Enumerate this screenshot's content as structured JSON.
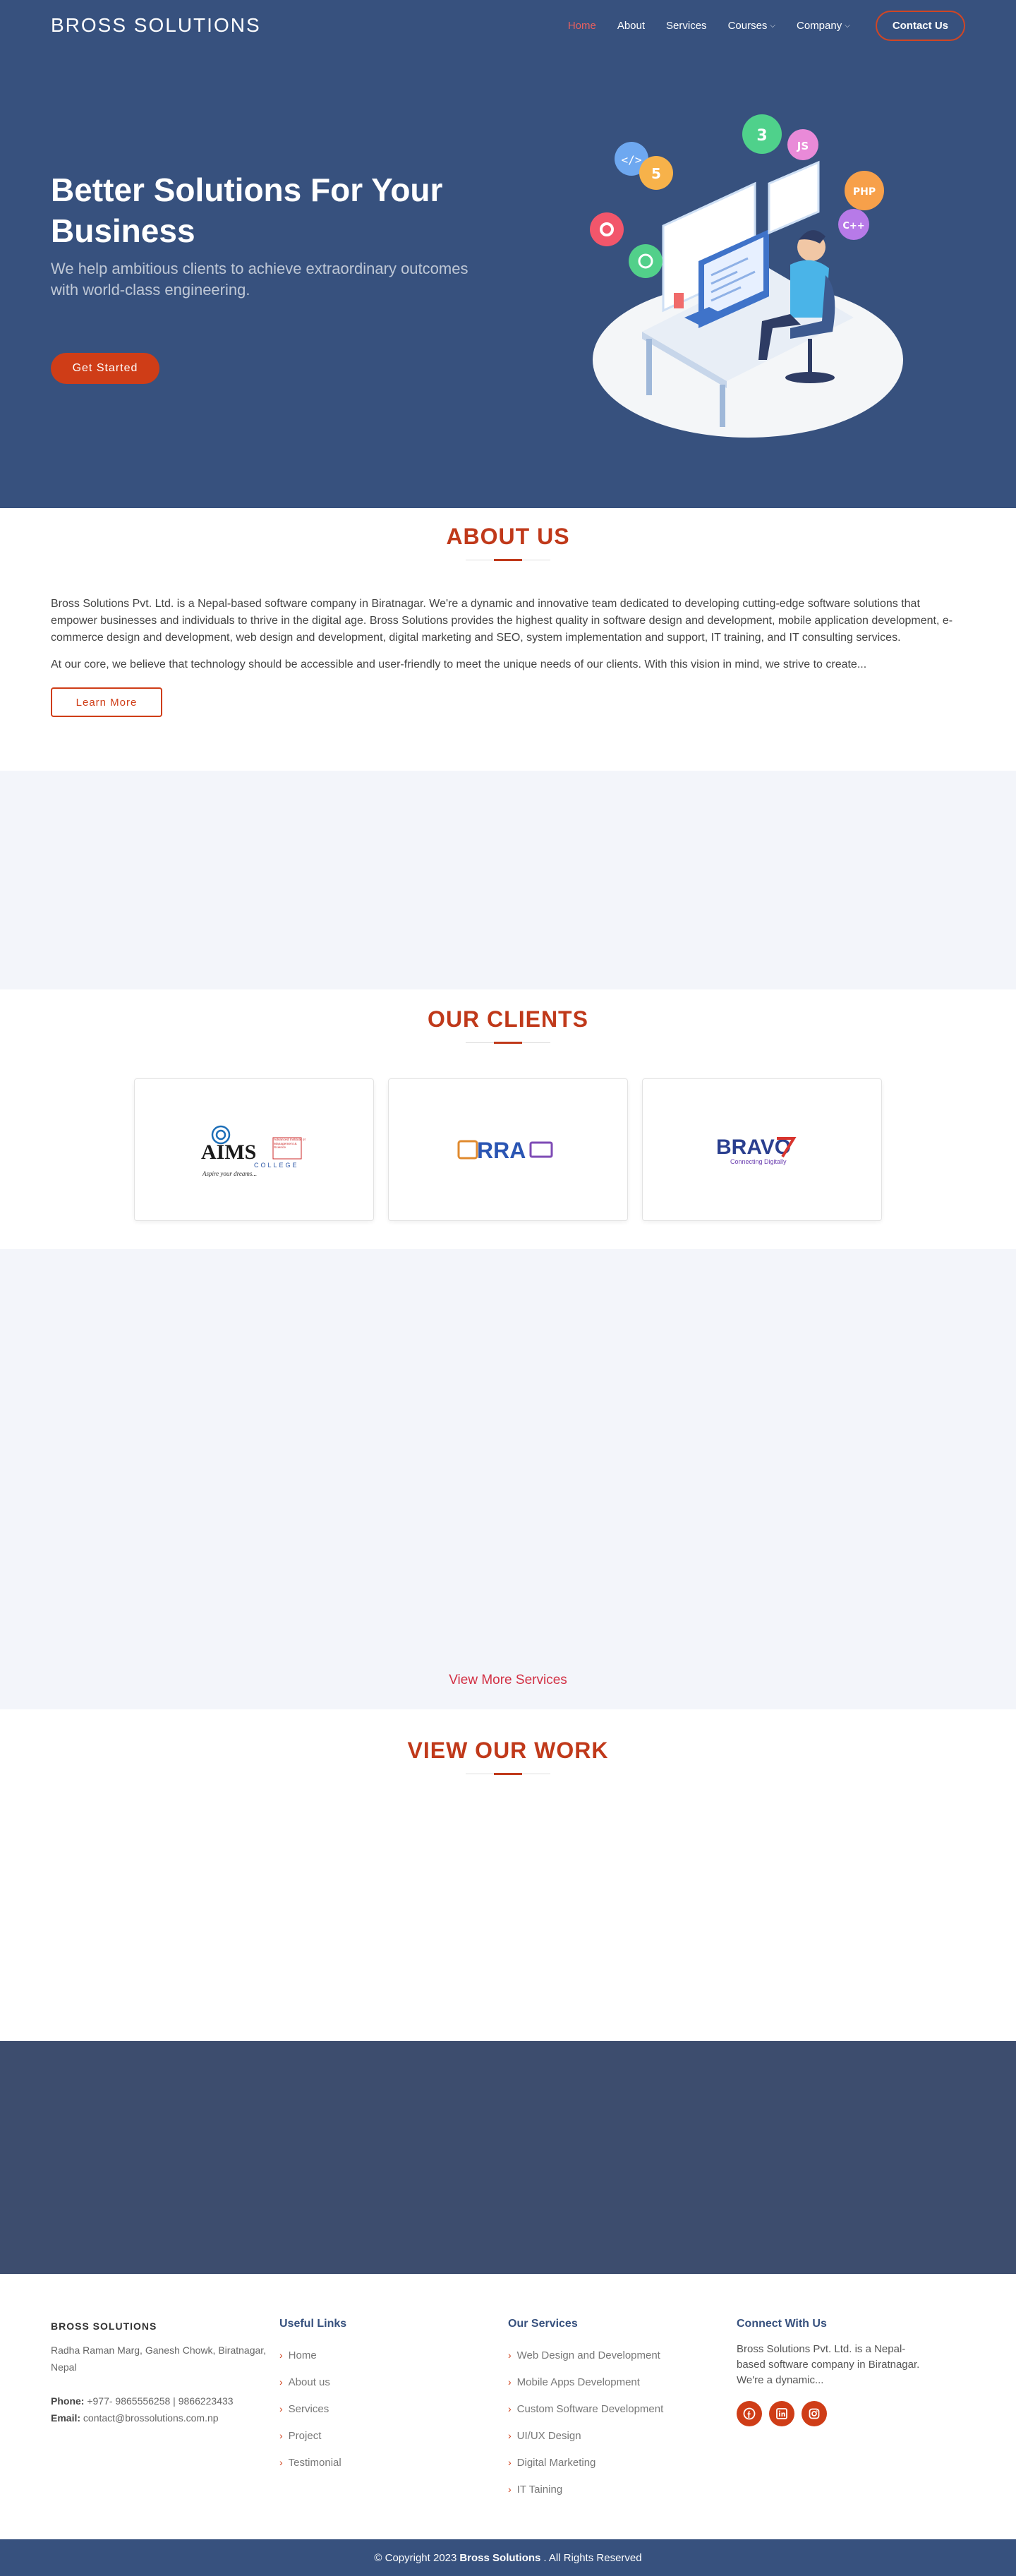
{
  "nav": {
    "brand": "BROSS SOLUTIONS",
    "items": [
      {
        "label": "Home",
        "active": true,
        "dropdown": false
      },
      {
        "label": "About",
        "active": false,
        "dropdown": false
      },
      {
        "label": "Services",
        "active": false,
        "dropdown": false
      },
      {
        "label": "Courses",
        "active": false,
        "dropdown": true
      },
      {
        "label": "Company",
        "active": false,
        "dropdown": true
      }
    ],
    "contact_label": "Contact Us"
  },
  "hero": {
    "title": "Better Solutions For Your Business",
    "subtitle": "We help ambitious clients to achieve extraordinary outcomes with world-class engineering.",
    "cta": "Get Started",
    "illustration_icons": [
      "code-icon",
      "html5-icon",
      "css3-icon",
      "js-icon",
      "php-icon",
      "cpp-icon",
      "settings-icon",
      "power-icon"
    ]
  },
  "about": {
    "title": "ABOUT US",
    "paragraph_1": "Bross Solutions Pvt. Ltd. is a Nepal-based software company in Biratnagar. We're a dynamic and innovative team dedicated to developing cutting-edge software solutions that empower businesses and individuals to thrive in the digital age. Bross Solutions provides the highest quality in software design and development, mobile application development, e-commerce design and development, web design and development, digital marketing and SEO, system implementation and support, IT training, and IT consulting services.",
    "paragraph_2": "At our core, we believe that technology should be accessible and user-friendly to meet the unique needs of our clients. With this vision in mind, we strive to create...",
    "button": "Learn More"
  },
  "clients": {
    "title": "OUR CLIENTS",
    "logos": [
      {
        "name": "AIMS",
        "sub": "COLLEGE",
        "tagline": "Aspire your dreams...",
        "side_text": "Advanced Institute of Management & Science"
      },
      {
        "name": "RRA"
      },
      {
        "name": "BRAVO",
        "tagline": "Connecting Digitally"
      }
    ]
  },
  "services": {
    "view_more": "View More Services"
  },
  "work": {
    "title": "VIEW OUR WORK"
  },
  "footer": {
    "brand": "BROSS SOLUTIONS",
    "address": "Radha Raman Marg, Ganesh Chowk, Biratnagar, Nepal",
    "phone_label": "Phone:",
    "phone": "+977- 9865556258 | 9866223433",
    "email_label": "Email:",
    "email": "contact@brossolutions.com.np",
    "useful_links_title": "Useful Links",
    "useful_links": [
      "Home",
      "About us",
      "Services",
      "Project",
      "Testimonial"
    ],
    "services_title": "Our Services",
    "services": [
      "Web Design and Development",
      "Mobile Apps Development",
      "Custom Software Development",
      "UI/UX Design",
      "Digital Marketing",
      "IT Taining"
    ],
    "connect_title": "Connect With Us",
    "connect_desc": "Bross Solutions Pvt. Ltd. is a Nepal-based software company in Biratnagar. We're a dynamic...",
    "socials": [
      "facebook-icon",
      "linkedin-icon",
      "instagram-icon"
    ]
  },
  "copyright": {
    "prefix": "© Copyright 2023",
    "company": "Bross Solutions",
    "suffix": ". All Rights Reserved"
  },
  "colors": {
    "hero_bg": "#37517e",
    "accent": "#cf3d17",
    "section_title": "#c0391a",
    "light_bg": "#f3f5fa",
    "dark_band": "#3d4d6e"
  }
}
